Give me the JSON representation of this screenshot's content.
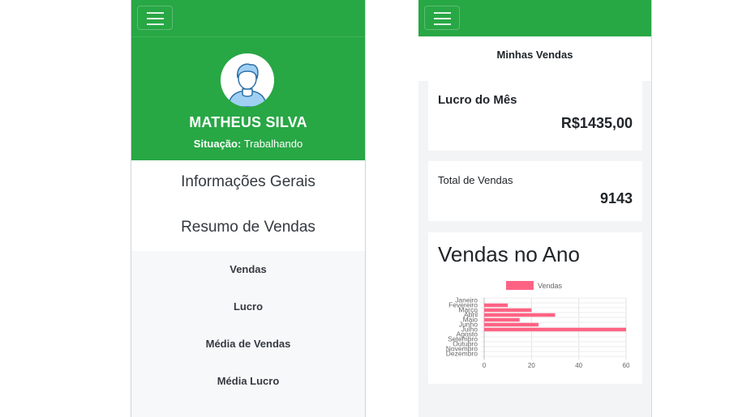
{
  "left_panel": {
    "profile": {
      "name": "MATHEUS SILVA",
      "status_label": "Situação:",
      "status_value": "Trabalhando"
    },
    "menu_main": [
      "Informações Gerais",
      "Resumo de Vendas"
    ],
    "menu_sub": [
      "Vendas",
      "Lucro",
      "Média de Vendas",
      "Média Lucro"
    ]
  },
  "right_panel": {
    "title": "Minhas Vendas",
    "lucro_card": {
      "label": "Lucro do Mês",
      "value": "R$1435,00"
    },
    "total_card": {
      "label": "Total de Vendas",
      "value": "9143"
    },
    "chart_card": {
      "title": "Vendas no Ano"
    }
  },
  "colors": {
    "brand_green": "#28a745",
    "bar_pink": "#ff6384"
  },
  "chart_data": {
    "type": "bar",
    "orientation": "horizontal",
    "title": "Vendas no Ano",
    "categories": [
      "Janeiro",
      "Fevereiro",
      "Março",
      "Abril",
      "Maio",
      "Junho",
      "Julho",
      "Agosto",
      "Setembro",
      "Outubro",
      "Novembro",
      "Dezembro"
    ],
    "series": [
      {
        "name": "Vendas",
        "values": [
          0,
          10,
          20,
          30,
          15,
          23,
          60,
          0,
          0,
          0,
          0,
          0
        ]
      }
    ],
    "xticks": [
      "0",
      "20",
      "40",
      "60"
    ],
    "xlim": [
      0,
      60
    ],
    "grid": true,
    "legend": "top"
  }
}
